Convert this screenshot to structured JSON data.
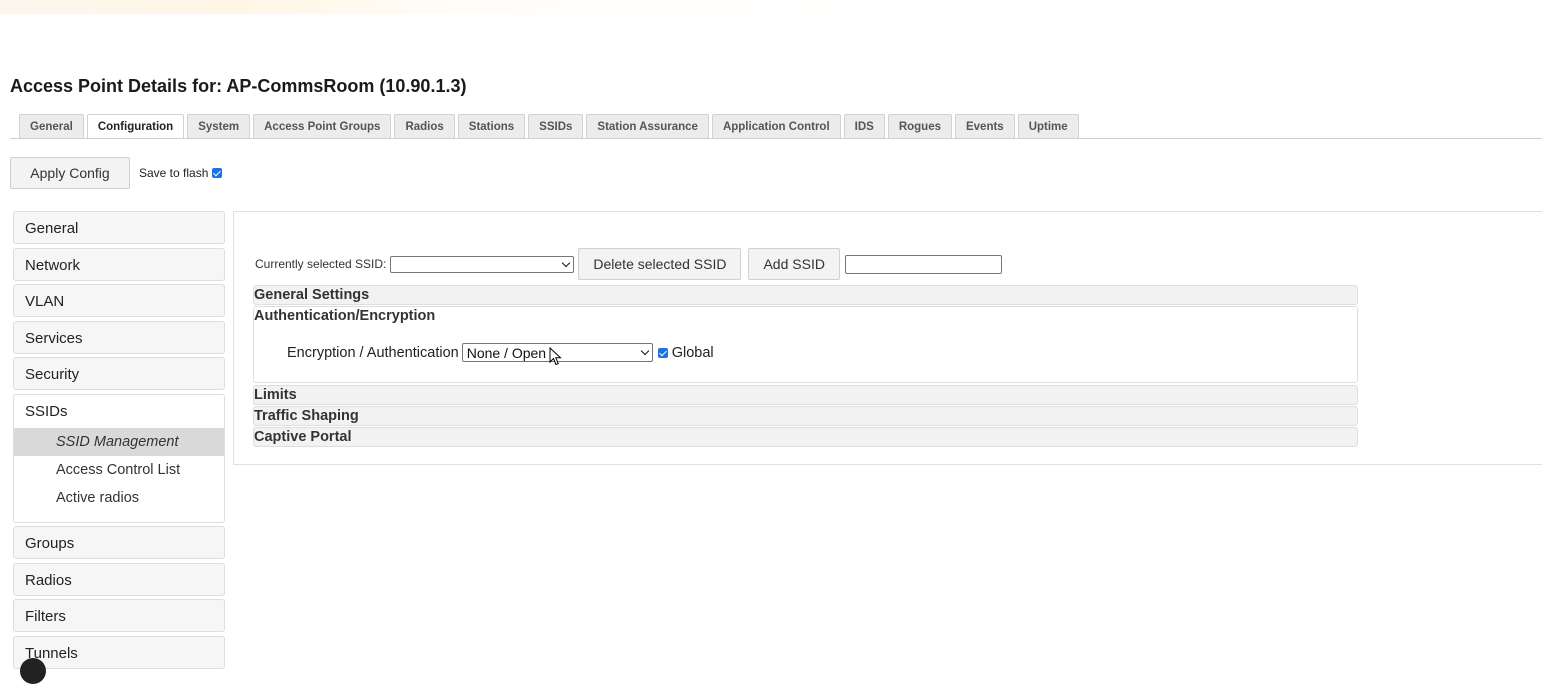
{
  "page": {
    "title": "Access Point Details for: AP-CommsRoom (10.90.1.3)"
  },
  "tabs": [
    {
      "label": "General",
      "active": false
    },
    {
      "label": "Configuration",
      "active": true
    },
    {
      "label": "System",
      "active": false
    },
    {
      "label": "Access Point Groups",
      "active": false
    },
    {
      "label": "Radios",
      "active": false
    },
    {
      "label": "Stations",
      "active": false
    },
    {
      "label": "SSIDs",
      "active": false
    },
    {
      "label": "Station Assurance",
      "active": false
    },
    {
      "label": "Application Control",
      "active": false
    },
    {
      "label": "IDS",
      "active": false
    },
    {
      "label": "Rogues",
      "active": false
    },
    {
      "label": "Events",
      "active": false
    },
    {
      "label": "Uptime",
      "active": false
    }
  ],
  "toolbar": {
    "apply_label": "Apply Config",
    "save_flash_label": "Save to flash",
    "save_flash_checked": true
  },
  "sidebar": {
    "items_top": [
      "General",
      "Network",
      "VLAN",
      "Services",
      "Security"
    ],
    "group": {
      "label": "SSIDs",
      "subitems": [
        {
          "label": "SSID Management",
          "active": true
        },
        {
          "label": "Access Control List",
          "active": false
        },
        {
          "label": "Active radios",
          "active": false
        }
      ]
    },
    "items_bottom": [
      "Groups",
      "Radios",
      "Filters",
      "Tunnels"
    ]
  },
  "ssid": {
    "selected_label": "Currently selected SSID:",
    "selected_value": "",
    "delete_label": "Delete selected SSID",
    "add_label": "Add SSID",
    "new_name_value": ""
  },
  "sections": {
    "general": "General Settings",
    "auth": "Authentication/Encryption",
    "limits": "Limits",
    "traffic": "Traffic Shaping",
    "captive": "Captive Portal"
  },
  "encryption": {
    "label": "Encryption / Authentication",
    "value": "None / Open",
    "global_label": "Global",
    "global_checked": true
  },
  "icons": {
    "dropdown": "chevron-down-icon",
    "checkbox": "checkbox-checked-icon",
    "cursor": "mouse-pointer-icon"
  },
  "colors": {
    "accent": "#1a73e8",
    "active_subitem_bg": "#d9d9d9"
  }
}
